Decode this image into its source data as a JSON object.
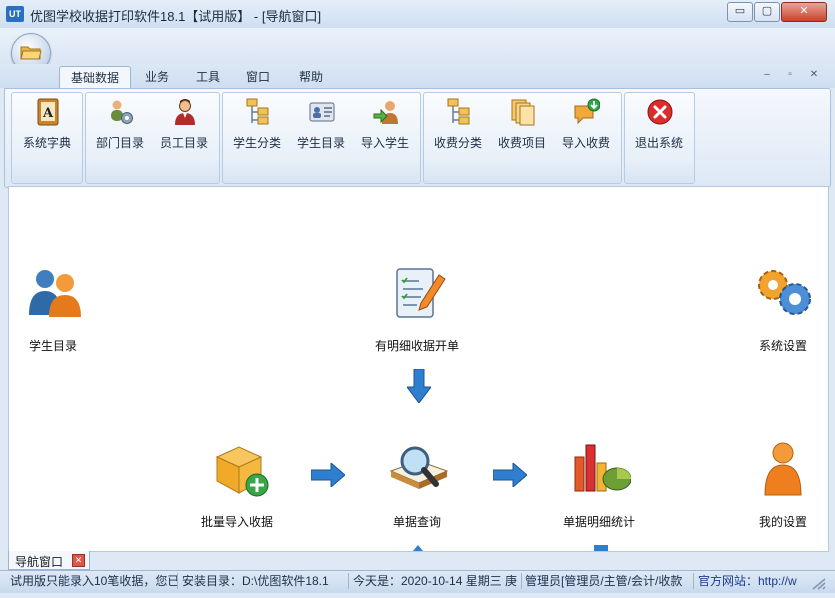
{
  "window": {
    "app_icon": "UT",
    "title": "优图学校收据打印软件18.1【试用版】 - [导航窗口]",
    "min": "▭",
    "max": "▢",
    "close": "✕"
  },
  "ribbon": {
    "tabs": [
      "基础数据",
      "业务",
      "工具",
      "窗口",
      "帮助"
    ],
    "active_tab": 0,
    "mdi_controls": [
      "–",
      "▫",
      "✕"
    ],
    "buttons": [
      {
        "label": "系统字典",
        "icon": "dictionary-icon"
      },
      {
        "label": "部门目录",
        "icon": "department-icon"
      },
      {
        "label": "员工目录",
        "icon": "employee-icon"
      },
      {
        "label": "学生分类",
        "icon": "student-category-icon"
      },
      {
        "label": "学生目录",
        "icon": "student-card-icon"
      },
      {
        "label": "导入学生",
        "icon": "import-student-icon"
      },
      {
        "label": "收费分类",
        "icon": "fee-category-icon"
      },
      {
        "label": "收费项目",
        "icon": "fee-item-icon"
      },
      {
        "label": "导入收费",
        "icon": "import-fee-icon"
      },
      {
        "label": "退出系统",
        "icon": "exit-icon"
      }
    ]
  },
  "navigation": {
    "items": [
      {
        "label": "学生目录",
        "icon": "people-icon"
      },
      {
        "label": "有明细收据开单",
        "icon": "form-edit-icon"
      },
      {
        "label": "系统设置",
        "icon": "gears-icon"
      },
      {
        "label": "批量导入收据",
        "icon": "box-add-icon"
      },
      {
        "label": "单据查询",
        "icon": "magnifier-book-icon"
      },
      {
        "label": "单据明细统计",
        "icon": "chart-icon"
      },
      {
        "label": "我的设置",
        "icon": "person-icon"
      }
    ]
  },
  "doc_tab": {
    "label": "导航窗口",
    "close": "✕"
  },
  "status_bar": [
    "试用版只能录入10笔收据，您已",
    "安装目录：D:\\优图软件18.1",
    "今天是：2020-10-14 星期三 庚",
    "管理员[管理员/主管/会计/收款",
    "官方网站：http://w"
  ],
  "colors": {
    "accent": "#2a6fc2",
    "close": "#c8412c",
    "content_bg": "#ffffff"
  }
}
